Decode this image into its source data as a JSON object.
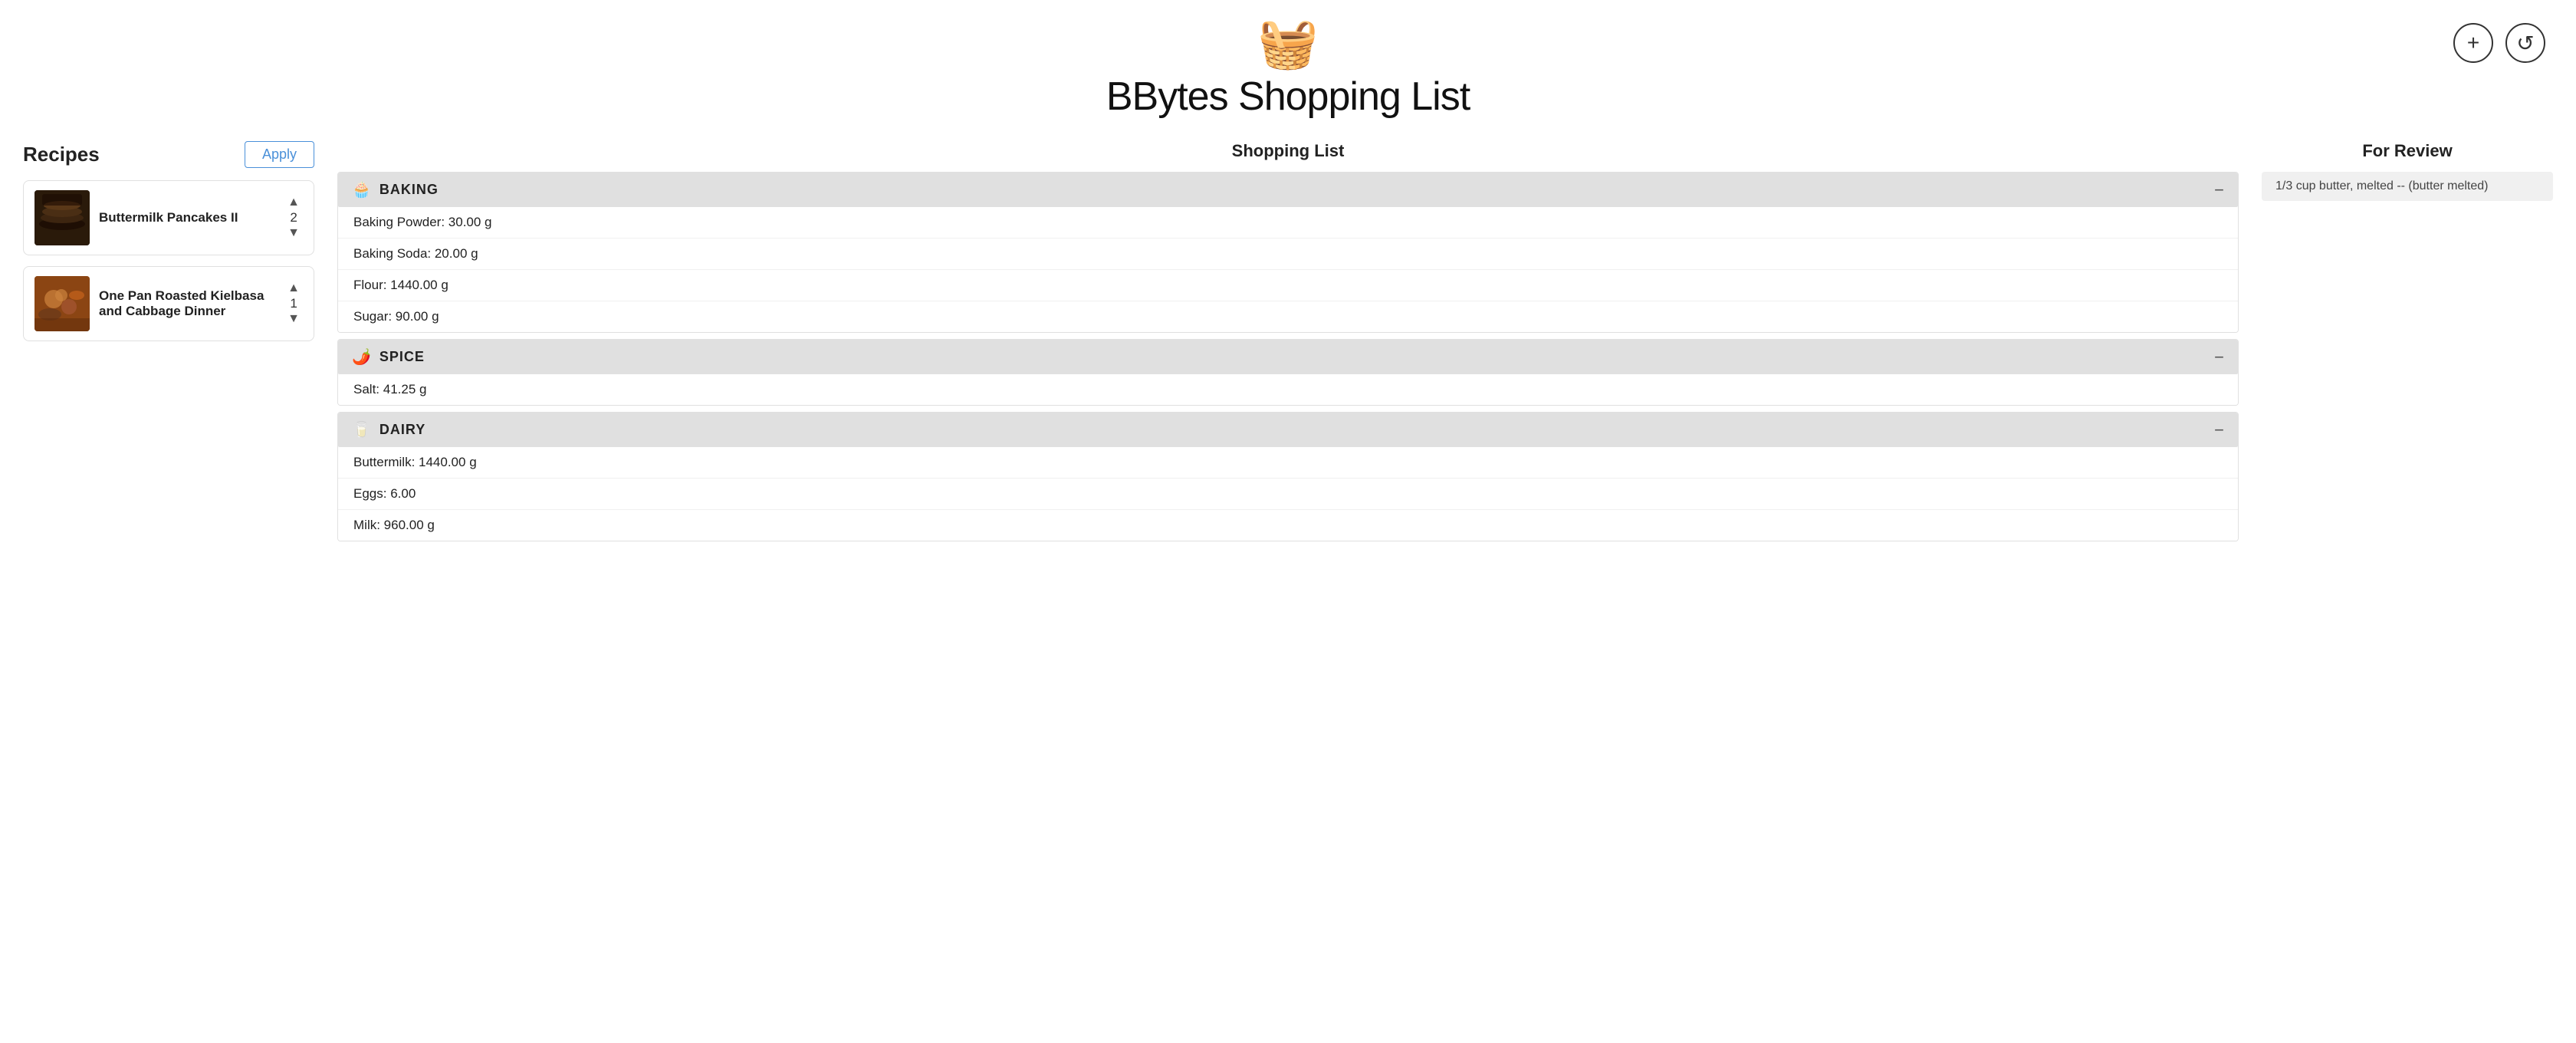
{
  "header": {
    "logo": "🛒",
    "title": "BBytes Shopping List",
    "add_button_label": "+",
    "refresh_button_label": "↺"
  },
  "recipes": {
    "section_title": "Recipes",
    "apply_button": "Apply",
    "items": [
      {
        "id": "buttermilk-pancakes",
        "name": "Buttermilk Pancakes II",
        "count": 2,
        "thumb_type": "pancakes"
      },
      {
        "id": "kielbasa-cabbage",
        "name": "One Pan Roasted Kielbasa and Cabbage Dinner",
        "count": 1,
        "thumb_type": "kielbasa"
      }
    ]
  },
  "shopping_list": {
    "section_title": "Shopping List",
    "categories": [
      {
        "name": "BAKING",
        "icon": "🧁",
        "collapsed": false,
        "ingredients": [
          "Baking Powder: 30.00 g",
          "Baking Soda: 20.00 g",
          "Flour: 1440.00 g",
          "Sugar: 90.00 g"
        ]
      },
      {
        "name": "SPICE",
        "icon": "🌶️",
        "collapsed": false,
        "ingredients": [
          "Salt: 41.25 g"
        ]
      },
      {
        "name": "DAIRY",
        "icon": "🥛",
        "collapsed": false,
        "ingredients": [
          "Buttermilk: 1440.00 g",
          "Eggs: 6.00",
          "Milk: 960.00 g"
        ]
      }
    ]
  },
  "for_review": {
    "section_title": "For Review",
    "items": [
      "1/3 cup butter, melted -- (butter melted)"
    ]
  }
}
